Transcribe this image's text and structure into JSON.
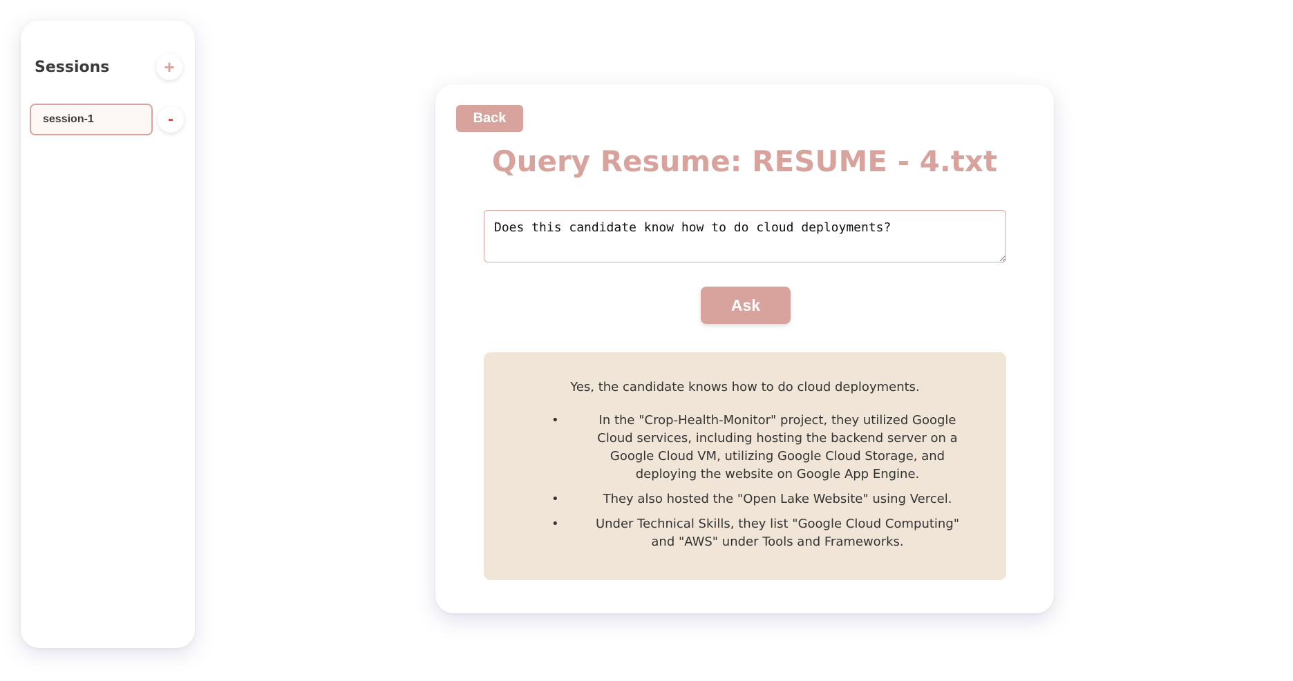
{
  "sidebar": {
    "title": "Sessions",
    "add_label": "+",
    "sessions": [
      {
        "name": "session-1",
        "remove_label": "-"
      }
    ]
  },
  "main": {
    "back_label": "Back",
    "title": "Query Resume: RESUME - 4.txt",
    "query_value": "Does this candidate know how to do cloud deployments?",
    "ask_label": "Ask",
    "answer": {
      "intro": "Yes, the candidate knows how to do cloud deployments.",
      "bullets": [
        "In the \"Crop-Health-Monitor\" project, they utilized Google Cloud services, including hosting the backend server on a Google Cloud VM, utilizing Google Cloud Storage, and deploying the website on Google App Engine.",
        "They also hosted the \"Open Lake Website\" using Vercel.",
        "Under Technical Skills, they list \"Google Cloud Computing\" and \"AWS\" under Tools and Frameworks."
      ]
    }
  },
  "colors": {
    "accent": "#d9a39d",
    "answer_bg": "#f0e5d7",
    "remove": "#d94a4a"
  }
}
